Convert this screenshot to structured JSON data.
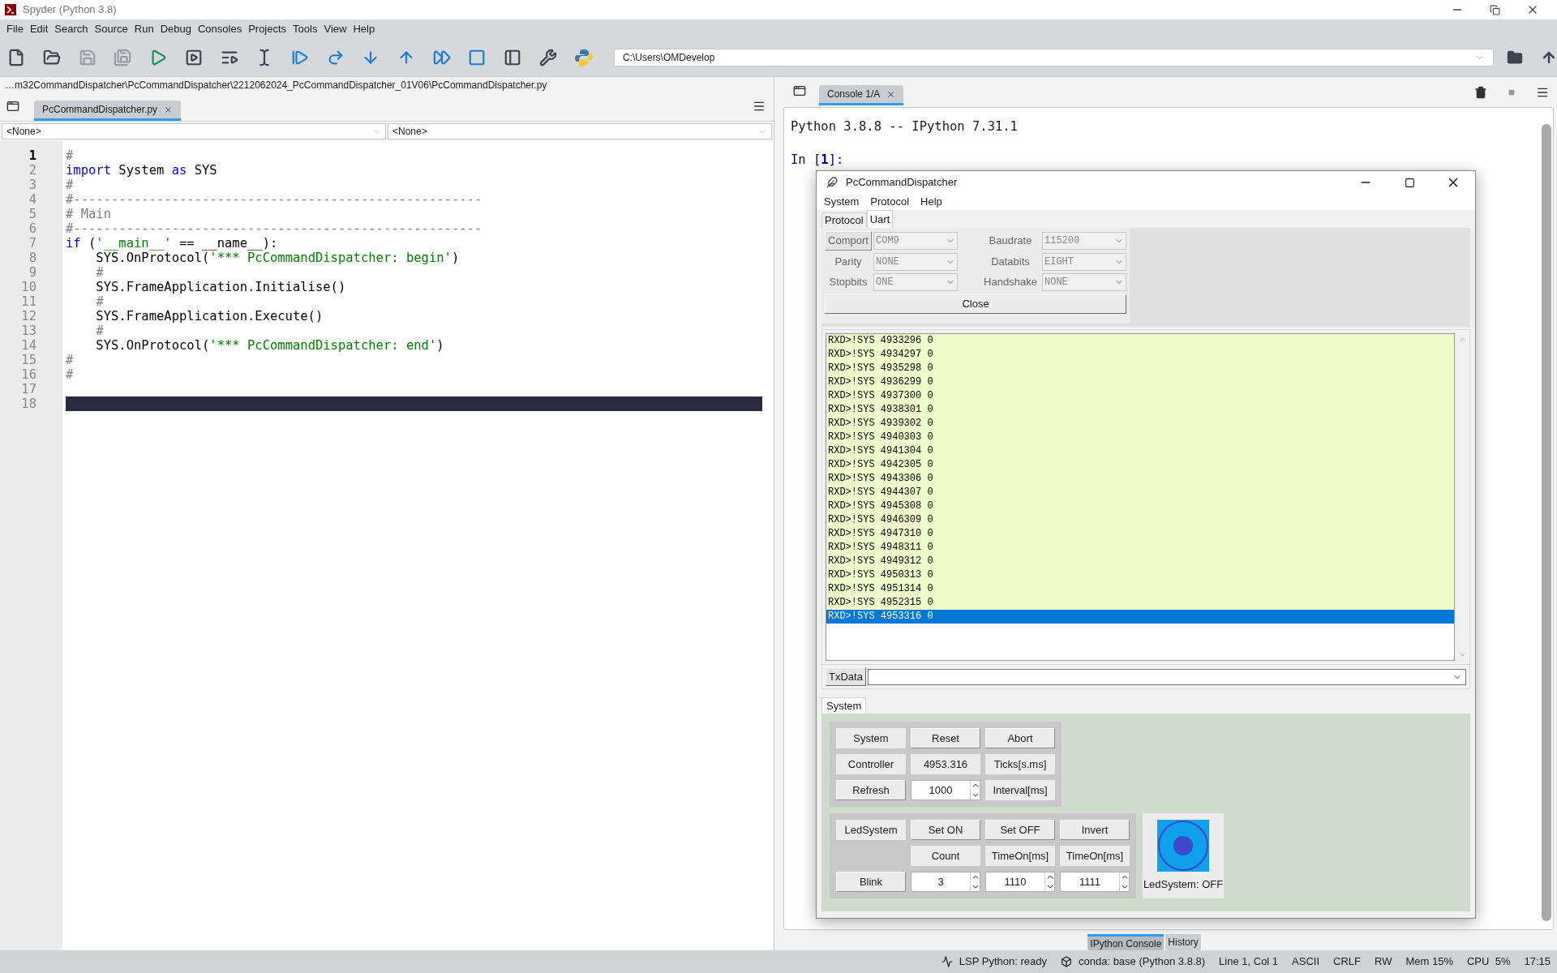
{
  "window": {
    "title": "Spyder (Python 3.8)"
  },
  "menu": [
    "File",
    "Edit",
    "Search",
    "Source",
    "Run",
    "Debug",
    "Consoles",
    "Projects",
    "Tools",
    "View",
    "Help"
  ],
  "toolbar": [
    {
      "kind": "new",
      "disabled": false
    },
    {
      "kind": "open",
      "disabled": false
    },
    {
      "kind": "save",
      "disabled": true
    },
    {
      "kind": "save_all",
      "disabled": true
    },
    {
      "kind": "run",
      "disabled": false
    },
    {
      "kind": "run_cell",
      "disabled": false
    },
    {
      "kind": "run_cell_advance",
      "disabled": false
    },
    {
      "kind": "run_selection",
      "disabled": false
    },
    {
      "kind": "debug",
      "disabled": false
    },
    {
      "kind": "step",
      "disabled": false
    },
    {
      "kind": "step_into",
      "disabled": false
    },
    {
      "kind": "step_return",
      "disabled": false
    },
    {
      "kind": "continue",
      "disabled": false
    },
    {
      "kind": "stop",
      "disabled": false
    },
    {
      "kind": "maximize",
      "disabled": false
    },
    {
      "kind": "preferences",
      "disabled": false
    },
    {
      "kind": "pythonpath",
      "disabled": false
    }
  ],
  "working_directory": {
    "value": "C:\\Users\\OMDevelop"
  },
  "editor": {
    "path": "…m32CommandDispatcher\\PcCommandDispatcher\\2212062024_PcCommandDispatcher_01V06\\PcCommandDispatcher.py",
    "tabs": [
      {
        "label": "PcCommandDispatcher.py",
        "selected": true
      }
    ],
    "class_selector": "<None>",
    "function_selector": "<None>",
    "lines": [
      {
        "number": "1",
        "current": true,
        "highlighted": false,
        "tokens": [
          {
            "kind": "comment",
            "text": "#"
          }
        ]
      },
      {
        "number": "2",
        "current": false,
        "highlighted": false,
        "tokens": [
          {
            "kind": "keyword",
            "text": "import"
          },
          {
            "kind": "plain",
            "text": " System "
          },
          {
            "kind": "keyword",
            "text": "as"
          },
          {
            "kind": "plain",
            "text": " SYS"
          }
        ]
      },
      {
        "number": "3",
        "current": false,
        "highlighted": false,
        "tokens": [
          {
            "kind": "comment",
            "text": "#"
          }
        ]
      },
      {
        "number": "4",
        "current": false,
        "highlighted": false,
        "tokens": [
          {
            "kind": "comment",
            "text": "#------------------------------------------------------"
          }
        ]
      },
      {
        "number": "5",
        "current": false,
        "highlighted": false,
        "tokens": [
          {
            "kind": "comment",
            "text": "# Main"
          }
        ]
      },
      {
        "number": "6",
        "current": false,
        "highlighted": false,
        "tokens": [
          {
            "kind": "comment",
            "text": "#------------------------------------------------------"
          }
        ]
      },
      {
        "number": "7",
        "current": false,
        "highlighted": false,
        "tokens": [
          {
            "kind": "keyword",
            "text": "if"
          },
          {
            "kind": "plain",
            "text": " ("
          },
          {
            "kind": "string",
            "text": "'__main__'"
          },
          {
            "kind": "plain",
            "text": " == __name__):"
          }
        ]
      },
      {
        "number": "8",
        "current": false,
        "highlighted": false,
        "tokens": [
          {
            "kind": "plain",
            "text": "    SYS.OnProtocol("
          },
          {
            "kind": "string",
            "text": "'*** PcCommandDispatcher: begin'"
          },
          {
            "kind": "plain",
            "text": ")"
          }
        ]
      },
      {
        "number": "9",
        "current": false,
        "highlighted": false,
        "tokens": [
          {
            "kind": "comment",
            "text": "    #"
          }
        ]
      },
      {
        "number": "10",
        "current": false,
        "highlighted": false,
        "tokens": [
          {
            "kind": "plain",
            "text": "    SYS.FrameApplication.Initialise()"
          }
        ]
      },
      {
        "number": "11",
        "current": false,
        "highlighted": false,
        "tokens": [
          {
            "kind": "comment",
            "text": "    #"
          }
        ]
      },
      {
        "number": "12",
        "current": false,
        "highlighted": false,
        "tokens": [
          {
            "kind": "plain",
            "text": "    SYS.FrameApplication.Execute()"
          }
        ]
      },
      {
        "number": "13",
        "current": false,
        "highlighted": false,
        "tokens": [
          {
            "kind": "comment",
            "text": "    #"
          }
        ]
      },
      {
        "number": "14",
        "current": false,
        "highlighted": false,
        "tokens": [
          {
            "kind": "plain",
            "text": "    SYS.OnProtocol("
          },
          {
            "kind": "string",
            "text": "'*** PcCommandDispatcher: end'"
          },
          {
            "kind": "plain",
            "text": ")"
          }
        ]
      },
      {
        "number": "15",
        "current": false,
        "highlighted": false,
        "tokens": [
          {
            "kind": "comment",
            "text": "#"
          }
        ]
      },
      {
        "number": "16",
        "current": false,
        "highlighted": false,
        "tokens": [
          {
            "kind": "comment",
            "text": "#"
          }
        ]
      },
      {
        "number": "17",
        "current": false,
        "highlighted": false
      },
      {
        "number": "18",
        "current": false,
        "highlighted": true
      }
    ]
  },
  "console": {
    "tabs": [
      {
        "label": "Console 1/A",
        "selected": true
      }
    ],
    "banner": "Python 3.8.8 -- IPython 7.31.1",
    "prompt_in": "In [",
    "prompt_num": "1",
    "prompt_end": "]:"
  },
  "dialog": {
    "title": "PcCommandDispatcher",
    "menu": [
      "System",
      "Protocol",
      "Help"
    ],
    "tabs": [
      {
        "label": "Protocol",
        "selected": false
      },
      {
        "label": "Uart",
        "selected": true
      }
    ],
    "uart_fields": [
      {
        "label": "Comport",
        "kind": "button",
        "value": "COM9",
        "disabled": true
      },
      {
        "label": "Baudrate",
        "kind": "label",
        "value": "115200",
        "disabled": true
      },
      {
        "label": "Parity",
        "kind": "label",
        "value": "NONE",
        "disabled": true
      },
      {
        "label": "Databits",
        "kind": "label",
        "value": "EIGHT",
        "disabled": true
      },
      {
        "label": "Stopbits",
        "kind": "label",
        "value": "ONE",
        "disabled": true
      },
      {
        "label": "Handshake",
        "kind": "label",
        "value": "NONE",
        "disabled": true
      }
    ],
    "close_button": "Close",
    "log": [
      {
        "text": "RXD>!SYS 4933296 0",
        "selected": false
      },
      {
        "text": "RXD>!SYS 4934297 0",
        "selected": false
      },
      {
        "text": "RXD>!SYS 4935298 0",
        "selected": false
      },
      {
        "text": "RXD>!SYS 4936299 0",
        "selected": false
      },
      {
        "text": "RXD>!SYS 4937300 0",
        "selected": false
      },
      {
        "text": "RXD>!SYS 4938301 0",
        "selected": false
      },
      {
        "text": "RXD>!SYS 4939302 0",
        "selected": false
      },
      {
        "text": "RXD>!SYS 4940303 0",
        "selected": false
      },
      {
        "text": "RXD>!SYS 4941304 0",
        "selected": false
      },
      {
        "text": "RXD>!SYS 4942305 0",
        "selected": false
      },
      {
        "text": "RXD>!SYS 4943306 0",
        "selected": false
      },
      {
        "text": "RXD>!SYS 4944307 0",
        "selected": false
      },
      {
        "text": "RXD>!SYS 4945308 0",
        "selected": false
      },
      {
        "text": "RXD>!SYS 4946309 0",
        "selected": false
      },
      {
        "text": "RXD>!SYS 4947310 0",
        "selected": false
      },
      {
        "text": "RXD>!SYS 4948311 0",
        "selected": false
      },
      {
        "text": "RXD>!SYS 4949312 0",
        "selected": false
      },
      {
        "text": "RXD>!SYS 4950313 0",
        "selected": false
      },
      {
        "text": "RXD>!SYS 4951314 0",
        "selected": false
      },
      {
        "text": "RXD>!SYS 4952315 0",
        "selected": false
      },
      {
        "text": "RXD>!SYS 4953316 0",
        "selected": true
      }
    ],
    "txdata_button": "TxData",
    "lower_tabs": [
      {
        "label": "System",
        "selected": true
      }
    ],
    "system_grid": [
      [
        {
          "kind": "label",
          "text": "System"
        },
        {
          "kind": "button",
          "text": "Reset"
        },
        {
          "kind": "button",
          "text": "Abort"
        }
      ],
      [
        {
          "kind": "label",
          "text": "Controller"
        },
        {
          "kind": "label",
          "text": "4953.316"
        },
        {
          "kind": "label",
          "text": "Ticks[s.ms]"
        }
      ],
      [
        {
          "kind": "button",
          "text": "Refresh"
        },
        {
          "kind": "spin",
          "text": "1000"
        },
        {
          "kind": "label",
          "text": "Interval[ms]"
        }
      ]
    ],
    "led_grid": [
      [
        {
          "kind": "label",
          "text": "LedSystem"
        },
        {
          "kind": "button",
          "text": "Set ON"
        },
        {
          "kind": "button",
          "text": "Set OFF"
        },
        {
          "kind": "button",
          "text": "Invert"
        }
      ],
      [
        {
          "kind": "empty"
        },
        {
          "kind": "label",
          "text": "Count"
        },
        {
          "kind": "label",
          "text": "TimeOn[ms]"
        },
        {
          "kind": "label",
          "text": "TimeOn[ms]"
        }
      ],
      [
        {
          "kind": "button",
          "text": "Blink"
        },
        {
          "kind": "spin",
          "text": "3"
        },
        {
          "kind": "spin",
          "text": "1110"
        },
        {
          "kind": "spin",
          "text": "1111"
        }
      ]
    ],
    "led": {
      "on": false,
      "caption": "LedSystem: OFF"
    }
  },
  "bottom_tabs": [
    {
      "label": "IPython Console",
      "selected": true
    },
    {
      "label": "History",
      "selected": false
    }
  ],
  "status_bar": [
    {
      "kind": "lsp",
      "text": "LSP Python: ready"
    },
    {
      "kind": "conda",
      "text": "conda: base (Python 3.8.8)"
    },
    {
      "kind": "text",
      "text": "Line 1, Col 1"
    },
    {
      "kind": "text",
      "text": "ASCII"
    },
    {
      "kind": "text",
      "text": "CRLF"
    },
    {
      "kind": "text",
      "text": "RW"
    },
    {
      "kind": "text",
      "text": "Mem 15%"
    },
    {
      "kind": "text",
      "text": "CPU  5%"
    },
    {
      "kind": "text",
      "text": "17:15"
    }
  ]
}
